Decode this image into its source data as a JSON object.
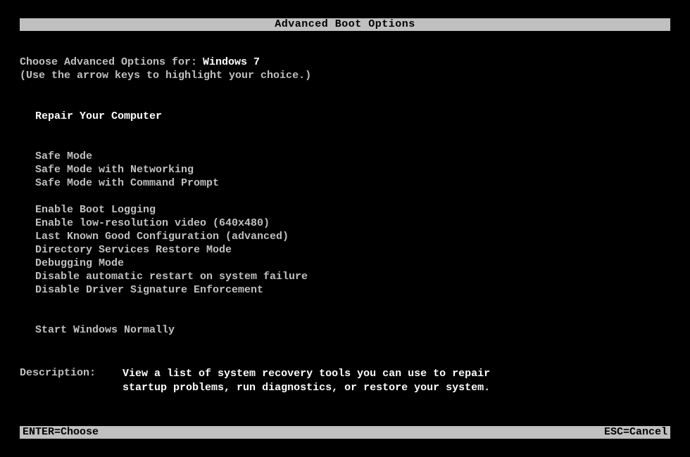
{
  "title": "Advanced Boot Options",
  "prompt": {
    "label": "Choose Advanced Options for:",
    "os": "Windows 7",
    "hint": "(Use the arrow keys to highlight your choice.)"
  },
  "menu": {
    "group1": [
      "Repair Your Computer"
    ],
    "group2": [
      "Safe Mode",
      "Safe Mode with Networking",
      "Safe Mode with Command Prompt"
    ],
    "group3": [
      "Enable Boot Logging",
      "Enable low-resolution video (640x480)",
      "Last Known Good Configuration (advanced)",
      "Directory Services Restore Mode",
      "Debugging Mode",
      "Disable automatic restart on system failure",
      "Disable Driver Signature Enforcement"
    ],
    "group4": [
      "Start Windows Normally"
    ]
  },
  "description": {
    "label": "Description:",
    "text_line1": "View a list of system recovery tools you can use to repair",
    "text_line2": "startup problems, run diagnostics, or restore your system."
  },
  "footer": {
    "choose": "ENTER=Choose",
    "cancel": "ESC=Cancel"
  }
}
